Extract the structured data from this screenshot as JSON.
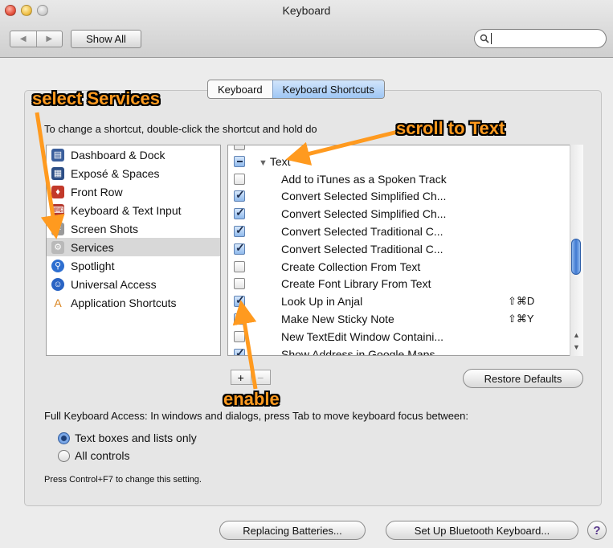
{
  "window": {
    "title": "Keyboard"
  },
  "toolbar": {
    "back_label": "◀",
    "forward_label": "▶",
    "show_all_label": "Show All",
    "search_value": ""
  },
  "tabs": [
    {
      "label": "Keyboard",
      "active": false
    },
    {
      "label": "Keyboard Shortcuts",
      "active": true
    }
  ],
  "instruction": "To change a shortcut, double-click the shortcut and hold do",
  "categories": [
    {
      "label": "Dashboard & Dock",
      "icon": "dashboard-icon"
    },
    {
      "label": "Exposé & Spaces",
      "icon": "expose-icon"
    },
    {
      "label": "Front Row",
      "icon": "front-row-icon"
    },
    {
      "label": "Keyboard & Text Input",
      "icon": "keyboard-icon"
    },
    {
      "label": "Screen Shots",
      "icon": "screenshot-icon"
    },
    {
      "label": "Services",
      "icon": "services-gear-icon",
      "selected": true
    },
    {
      "label": "Spotlight",
      "icon": "spotlight-icon"
    },
    {
      "label": "Universal Access",
      "icon": "universal-access-icon"
    },
    {
      "label": "Application Shortcuts",
      "icon": "app-shortcuts-icon"
    }
  ],
  "shortcuts": {
    "group_label": "Text",
    "items": [
      {
        "label": "Add to iTunes as a Spoken Track",
        "checked": false,
        "keys": ""
      },
      {
        "label": "Convert Selected Simplified Ch...",
        "checked": true,
        "keys": ""
      },
      {
        "label": "Convert Selected Simplified Ch...",
        "checked": true,
        "keys": ""
      },
      {
        "label": "Convert Selected Traditional C...",
        "checked": true,
        "keys": ""
      },
      {
        "label": "Convert Selected Traditional C...",
        "checked": true,
        "keys": ""
      },
      {
        "label": "Create Collection From Text",
        "checked": false,
        "keys": ""
      },
      {
        "label": "Create Font Library From Text",
        "checked": false,
        "keys": ""
      },
      {
        "label": "Look Up in Anjal",
        "checked": true,
        "keys": "⇧⌘D"
      },
      {
        "label": "Make New Sticky Note",
        "checked": true,
        "keys": "⇧⌘Y"
      },
      {
        "label": "New TextEdit Window Containi...",
        "checked": false,
        "keys": ""
      },
      {
        "label": "Show Address in Google Maps",
        "checked": true,
        "keys": ""
      }
    ]
  },
  "buttons": {
    "add": "+",
    "remove": "−",
    "restore_defaults": "Restore Defaults",
    "replacing_batteries": "Replacing Batteries...",
    "setup_bluetooth": "Set Up Bluetooth Keyboard...",
    "help": "?"
  },
  "full_keyboard_access": {
    "text": "Full Keyboard Access: In windows and dialogs, press Tab to move keyboard focus between:",
    "options": [
      {
        "label": "Text boxes and lists only",
        "selected": true
      },
      {
        "label": "All controls",
        "selected": false
      }
    ],
    "hint": "Press Control+F7 to change this setting."
  },
  "annotations": {
    "select_services": "select Services",
    "scroll_to_text": "scroll to Text",
    "enable": "enable"
  },
  "colors": {
    "annotation": "#ff9a1f",
    "selection": "#3f79d1"
  }
}
